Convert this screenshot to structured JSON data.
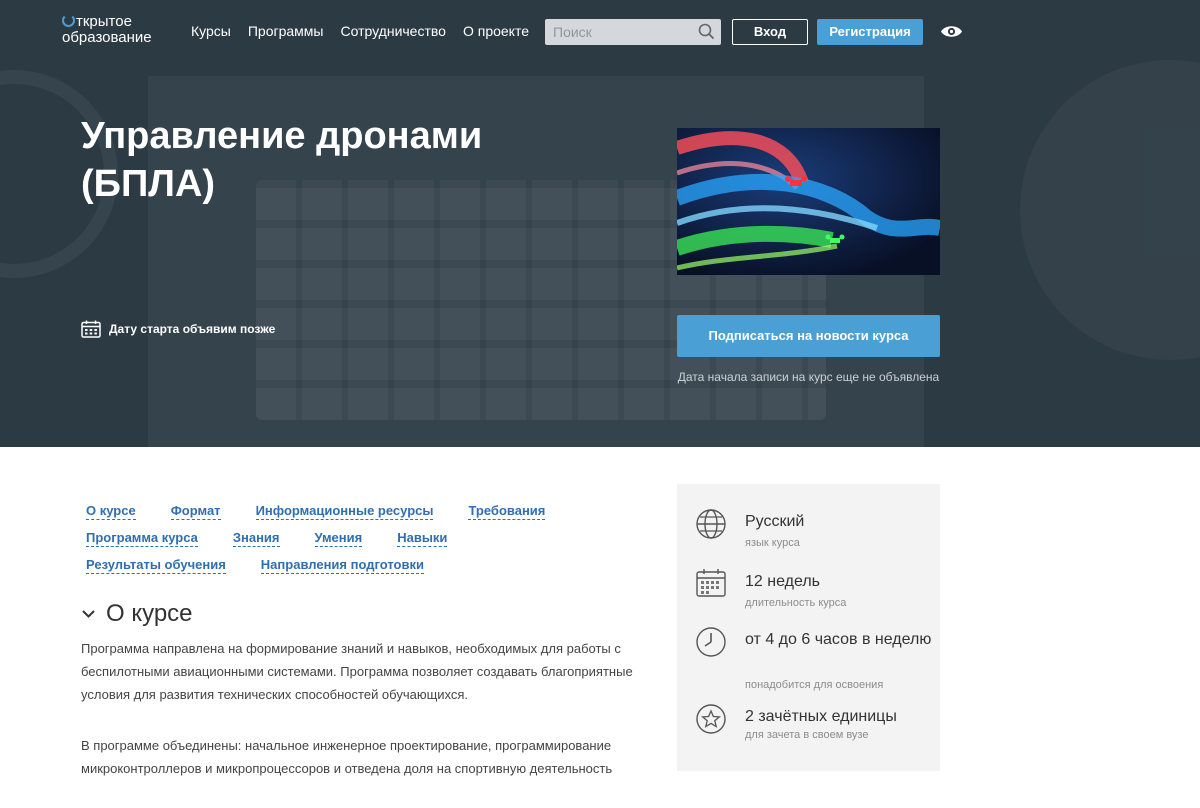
{
  "header": {
    "logo_line1": "ткрытое",
    "logo_line2": "образование",
    "nav": [
      "Курсы",
      "Программы",
      "Сотрудничество",
      "О проекте"
    ],
    "search_placeholder": "Поиск",
    "login_label": "Вход",
    "register_label": "Регистрация"
  },
  "hero": {
    "title": "Управление дронами (БПЛА)",
    "start_date": "Дату старта объявим позже",
    "subscribe_label": "Подписаться на новости курса",
    "enroll_note": "Дата начала записи на курс еще не объявлена"
  },
  "anchors": [
    [
      "О курсе",
      "Формат",
      "Информационные ресурсы",
      "Требования"
    ],
    [
      "Программа курса",
      "Знания",
      "Умения",
      "Навыки"
    ],
    [
      "Результаты обучения",
      "Направления подготовки"
    ]
  ],
  "about": {
    "heading": "О курсе",
    "paragraphs": [
      "Программа направлена на формирование знаний и навыков, необходимых для работы с беспилотными авиационными системами. Программа позволяет создавать благоприятные условия для развития технических способностей обучающихся.",
      "В программе объединены: начальное инженерное проектирование, программирование микроконтроллеров и микропроцессоров и отведена доля на спортивную деятельность"
    ]
  },
  "course_info": {
    "language": {
      "value": "Русский",
      "label": "язык курса",
      "icon": "globe-icon"
    },
    "duration": {
      "value": "12 недель",
      "label": "длительность курса",
      "icon": "calendar-icon"
    },
    "workload": {
      "value": "от 4 до 6 часов в неделю",
      "label": "понадобится для освоения",
      "icon": "clock-icon"
    },
    "credits": {
      "value": "2 зачётных единицы",
      "label": "для зачета в своем вузе",
      "icon": "star-icon"
    }
  },
  "colors": {
    "hero_bg": "#2c3a44",
    "accent": "#4a9fd5",
    "link": "#2f6fb1",
    "sidebar_bg": "#f3f3f3"
  }
}
